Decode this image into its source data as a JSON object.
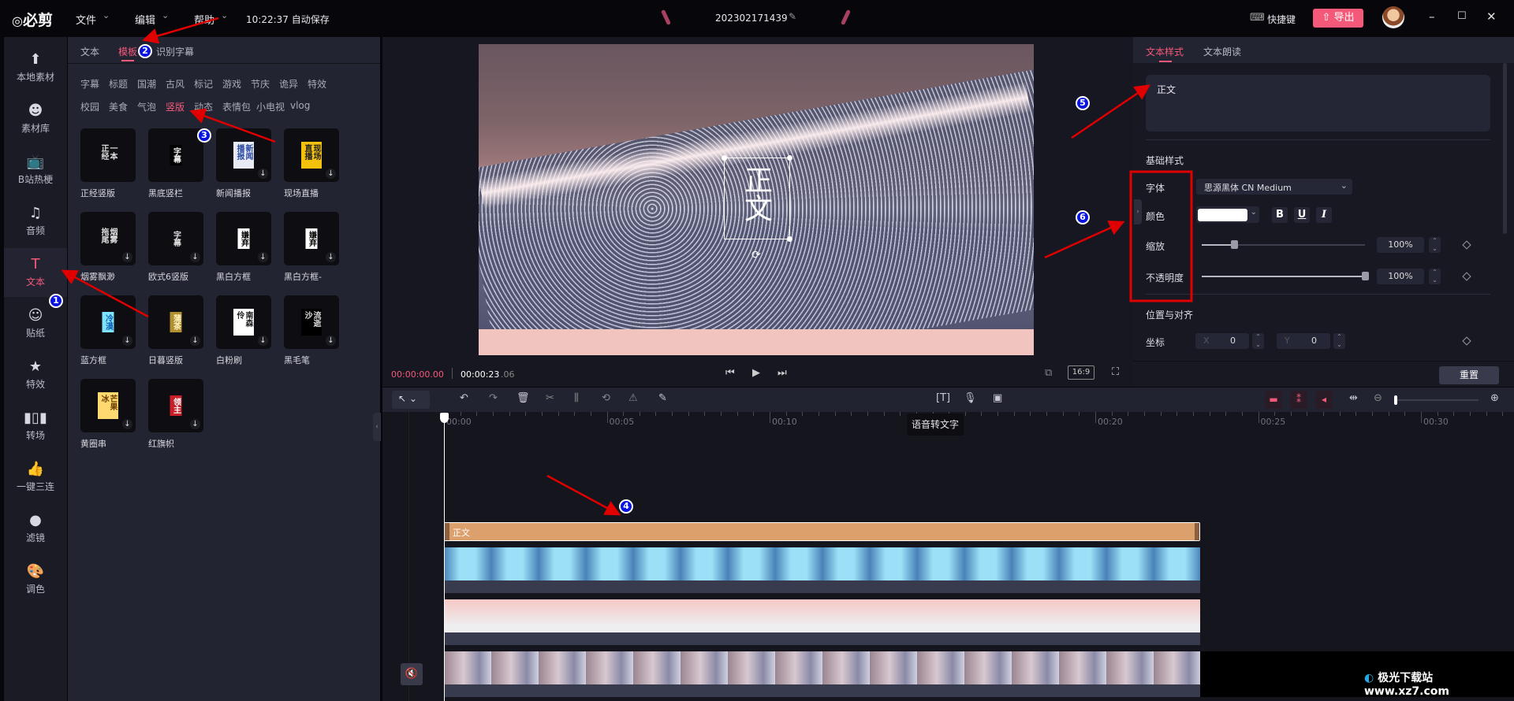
{
  "colors": {
    "accent": "#f5597a",
    "text_clip": "#dba06c",
    "annotation": "#e00000",
    "annotation_badge": "#0a14e0"
  },
  "topbar": {
    "logo": "必剪",
    "menus": [
      {
        "label": "文件"
      },
      {
        "label": "编辑"
      },
      {
        "label": "帮助"
      }
    ],
    "autosave": "10:22:37 自动保存",
    "project_title": "202302171439",
    "shortcuts": "快捷键",
    "export": "导出"
  },
  "sidebar": {
    "items": [
      {
        "label": "本地素材",
        "icon": "folder-upload-icon",
        "glyph": "⬆"
      },
      {
        "label": "素材库",
        "icon": "library-icon",
        "glyph": "☻"
      },
      {
        "label": "B站热梗",
        "icon": "bilibili-tv-icon",
        "glyph": "📺"
      },
      {
        "label": "音频",
        "icon": "music-note-icon",
        "glyph": "♫"
      },
      {
        "label": "文本",
        "icon": "text-t-icon",
        "glyph": "T",
        "active": true
      },
      {
        "label": "贴纸",
        "icon": "sticker-icon",
        "glyph": "☺"
      },
      {
        "label": "特效",
        "icon": "star-effect-icon",
        "glyph": "★"
      },
      {
        "label": "转场",
        "icon": "transition-icon",
        "glyph": "▮▯▮"
      },
      {
        "label": "一键三连",
        "icon": "thumbs-up-icon",
        "glyph": "👍"
      },
      {
        "label": "滤镜",
        "icon": "filter-circles-icon",
        "glyph": "●"
      },
      {
        "label": "调色",
        "icon": "palette-icon",
        "glyph": "🎨"
      }
    ]
  },
  "left_panel": {
    "tabs": [
      {
        "label": "文本"
      },
      {
        "label": "模板",
        "active": true
      },
      {
        "label": "识别字幕"
      }
    ],
    "categories_row1": [
      "字幕",
      "标题",
      "国潮",
      "古风",
      "标记",
      "游戏",
      "节庆",
      "诡异",
      "特效"
    ],
    "categories_row2": [
      "校园",
      "美食",
      "气泡",
      "竖版",
      "动态",
      "表情包",
      "小电视",
      "vlog"
    ],
    "active_category": "竖版",
    "templates": [
      {
        "label": "正经竖版",
        "thumb": "一本正经",
        "bg": "transparent",
        "fg": "#ddd",
        "download": false
      },
      {
        "label": "黑底竖栏",
        "thumb": "字幕",
        "bg": "#000",
        "fg": "#eee",
        "download": false
      },
      {
        "label": "新闻播报",
        "thumb": "新闻播报",
        "bg": "#e8eaf4",
        "fg": "#2a4aa0",
        "download": true
      },
      {
        "label": "现场直播",
        "thumb": "现场直播",
        "bg": "#f4c20d",
        "fg": "#222",
        "download": true
      },
      {
        "label": "烟雾飘渺",
        "thumb": "烟雾拖尾",
        "bg": "transparent",
        "fg": "#ddd",
        "download": true
      },
      {
        "label": "欧式6竖版",
        "thumb": "字幕",
        "bg": "transparent",
        "fg": "#ddd",
        "download": true
      },
      {
        "label": "黑白方框",
        "thumb": "嫌弃",
        "bg": "#fff",
        "fg": "#000",
        "download": true
      },
      {
        "label": "黑白方框-",
        "thumb": "嫌弃",
        "bg": "#fff",
        "fg": "#000",
        "download": true
      },
      {
        "label": "蓝方框",
        "thumb": "冷漠",
        "bg": "#7fe3ff",
        "fg": "#1060b0",
        "download": true
      },
      {
        "label": "日暮竖版",
        "thumb": "蒲茶",
        "bg": "#b09030",
        "fg": "#fff3c0",
        "download": true
      },
      {
        "label": "白粉刷",
        "thumb": "南森伶",
        "bg": "#fff",
        "fg": "#222",
        "download": true
      },
      {
        "label": "黑毛笔",
        "thumb": "流逝沙",
        "bg": "#000",
        "fg": "#ddd",
        "download": true
      },
      {
        "label": "黄圈串",
        "thumb": "芒果冰",
        "bg": "#ffd870",
        "fg": "#6a4000",
        "download": true
      },
      {
        "label": "红旗帜",
        "thumb": "领主",
        "bg": "#c8202a",
        "fg": "#fff",
        "download": true
      }
    ]
  },
  "preview": {
    "overlay_text": "正文",
    "current_time": "00:00:00.00",
    "total_time_main": "00:00:23",
    "total_time_frac": ".06",
    "aspect_ratio": "16:9"
  },
  "right_panel": {
    "tabs": [
      {
        "label": "文本样式",
        "active": true
      },
      {
        "label": "文本朗读"
      }
    ],
    "text_value": "正文",
    "basic_style": "基础样式",
    "font_label": "字体",
    "font_value": "思源黑体 CN Medium",
    "color_label": "颜色",
    "color_value": "#ffffff",
    "bold": "B",
    "underline": "U",
    "italic": "I",
    "scale_label": "缩放",
    "scale_value": "100%",
    "scale_slider": 0.2,
    "opacity_label": "不透明度",
    "opacity_value": "100%",
    "opacity_slider": 1.0,
    "position_title": "位置与对齐",
    "coord_label": "坐标",
    "x_label": "X",
    "x_value": "0",
    "y_label": "Y",
    "y_value": "0",
    "reset": "重置"
  },
  "toolbar": {
    "tooltip": "语音转文字"
  },
  "timeline": {
    "ruler_labels": [
      "00:00",
      "00:05",
      "00:10",
      "00:15",
      "00:20",
      "00:25",
      "00:30"
    ],
    "text_clip_label": "正文",
    "duration_seconds": 23.06
  },
  "annotations": [
    "1",
    "2",
    "3",
    "4",
    "5",
    "6"
  ],
  "watermark": "极光下载站 www.xz7.com"
}
